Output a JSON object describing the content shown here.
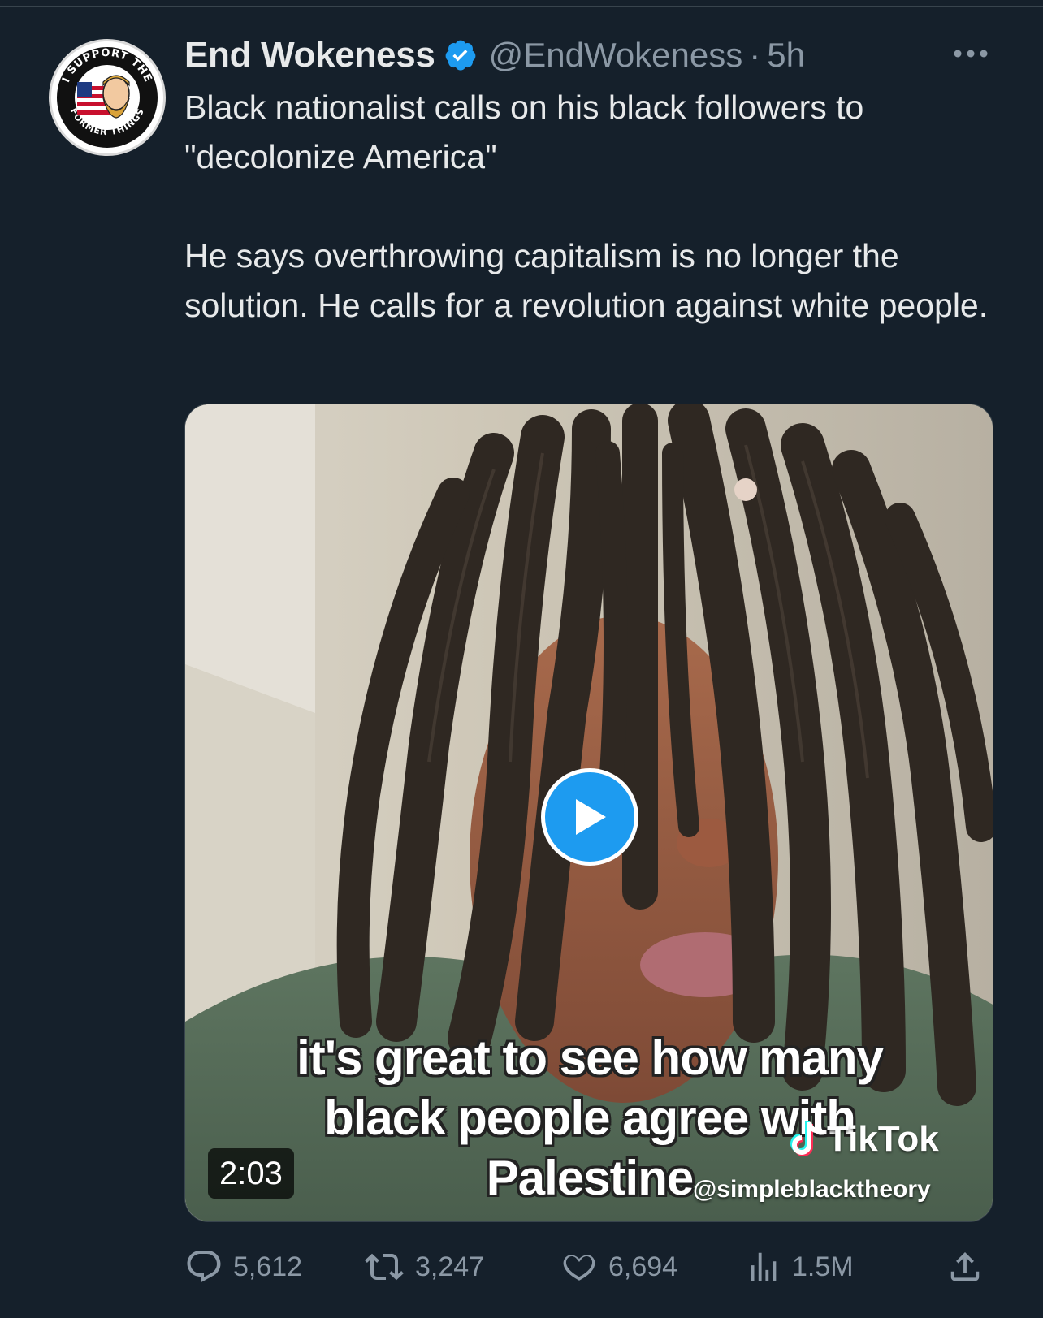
{
  "tweet": {
    "display_name": "End Wokeness",
    "handle": "@EndWokeness",
    "separator": "·",
    "time": "5h",
    "more_label": "•••",
    "paragraphs": [
      "Black nationalist calls on his black followers to \"decolonize America\"",
      "He says overthrowing capitalism is no longer the solution. He calls for a revolution against white people."
    ],
    "avatar": {
      "top_text": "I SUPPORT THE",
      "bottom_text": "FORMER THINGS"
    }
  },
  "media": {
    "duration": "2:03",
    "caption_lines": [
      "it's great to see how many",
      "black people agree with",
      "Palestine"
    ],
    "watermark_brand": "TikTok",
    "watermark_handle": "@simpleblacktheory"
  },
  "actions": {
    "replies": "5,612",
    "reposts": "3,247",
    "likes": "6,694",
    "views": "1.5M"
  },
  "colors": {
    "background": "#15202b",
    "text_primary": "#e7e9ea",
    "text_secondary": "#8b98a5",
    "accent": "#1d9bf0"
  },
  "icons": [
    "verified-badge-icon",
    "more-icon",
    "play-icon",
    "reply-icon",
    "repost-icon",
    "like-icon",
    "views-icon",
    "share-icon",
    "tiktok-icon"
  ]
}
